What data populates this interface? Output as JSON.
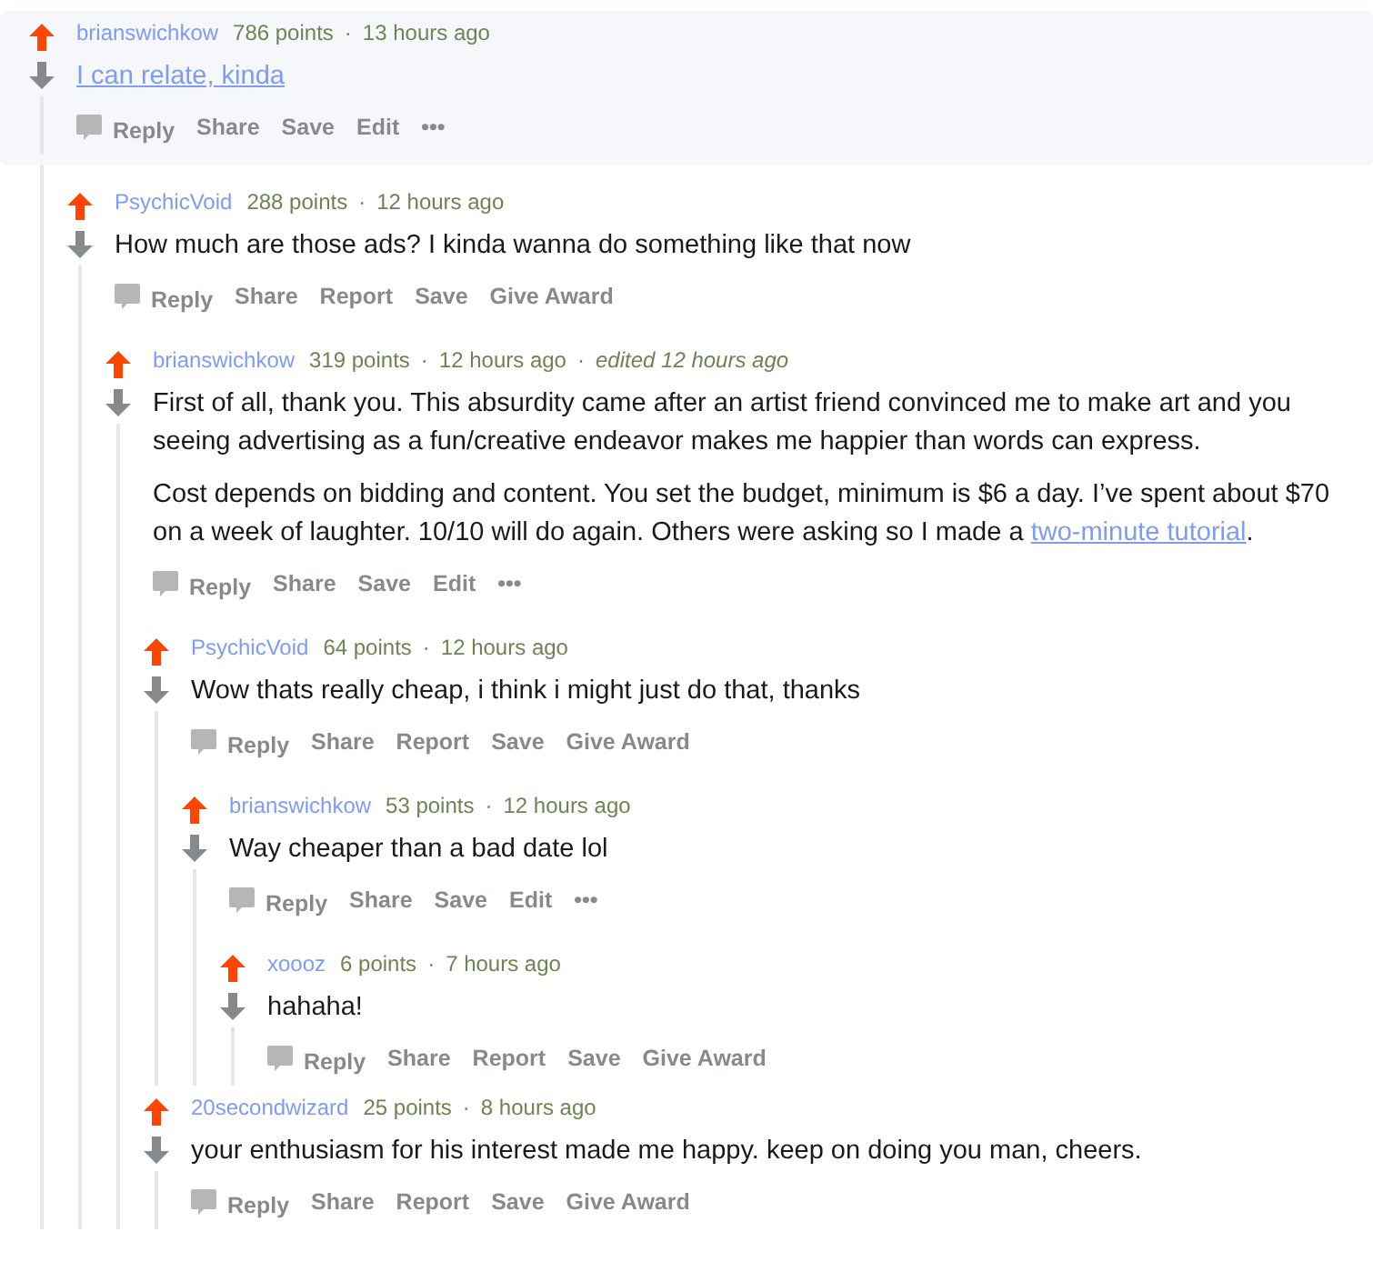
{
  "comments": [
    {
      "user": "brianswichkow",
      "upvoted": true,
      "highlighted": true,
      "meta": [
        {
          "text": "786 points"
        },
        {
          "text": "·"
        },
        {
          "text": "13 hours ago"
        }
      ],
      "body": [
        [
          {
            "kind": "link",
            "text": "I can relate, kinda"
          }
        ]
      ],
      "actions": [
        {
          "kind": "reply",
          "text": "Reply"
        },
        {
          "kind": "plain",
          "text": "Share"
        },
        {
          "kind": "plain",
          "text": "Save"
        },
        {
          "kind": "plain",
          "text": "Edit"
        },
        {
          "kind": "more",
          "text": "•••"
        }
      ],
      "children": [
        {
          "user": "PsychicVoid",
          "upvoted": true,
          "meta": [
            {
              "text": "288 points"
            },
            {
              "text": "·"
            },
            {
              "text": "12 hours ago"
            }
          ],
          "body": [
            [
              {
                "kind": "text",
                "text": "How much are those ads? I kinda wanna do something like that now"
              }
            ]
          ],
          "actions": [
            {
              "kind": "reply",
              "text": "Reply"
            },
            {
              "kind": "plain",
              "text": "Share"
            },
            {
              "kind": "plain",
              "text": "Report"
            },
            {
              "kind": "plain",
              "text": "Save"
            },
            {
              "kind": "plain",
              "text": "Give Award"
            }
          ],
          "children": [
            {
              "user": "brianswichkow",
              "upvoted": true,
              "meta": [
                {
                  "text": "319 points"
                },
                {
                  "text": "·"
                },
                {
                  "text": "12 hours ago"
                },
                {
                  "text": "·"
                },
                {
                  "text": "edited 12 hours ago",
                  "italic": true
                }
              ],
              "body": [
                [
                  {
                    "kind": "text",
                    "text": "First of all, thank you. This absurdity came after an artist friend convinced me to make art and you seeing advertising as a fun/creative endeavor makes me happier than words can express."
                  }
                ],
                [
                  {
                    "kind": "text",
                    "text": "Cost depends on bidding and content. You set the budget, minimum is $6 a day. I’ve spent about $70 on a week of laughter. 10/10 will do again. Others were asking so I made a "
                  },
                  {
                    "kind": "link",
                    "text": "two-minute tutorial"
                  },
                  {
                    "kind": "text",
                    "text": "."
                  }
                ]
              ],
              "actions": [
                {
                  "kind": "reply",
                  "text": "Reply"
                },
                {
                  "kind": "plain",
                  "text": "Share"
                },
                {
                  "kind": "plain",
                  "text": "Save"
                },
                {
                  "kind": "plain",
                  "text": "Edit"
                },
                {
                  "kind": "more",
                  "text": "•••"
                }
              ],
              "children": [
                {
                  "user": "PsychicVoid",
                  "upvoted": true,
                  "meta": [
                    {
                      "text": "64 points"
                    },
                    {
                      "text": "·"
                    },
                    {
                      "text": "12 hours ago"
                    }
                  ],
                  "body": [
                    [
                      {
                        "kind": "text",
                        "text": "Wow thats really cheap, i think i might just do that, thanks"
                      }
                    ]
                  ],
                  "actions": [
                    {
                      "kind": "reply",
                      "text": "Reply"
                    },
                    {
                      "kind": "plain",
                      "text": "Share"
                    },
                    {
                      "kind": "plain",
                      "text": "Report"
                    },
                    {
                      "kind": "plain",
                      "text": "Save"
                    },
                    {
                      "kind": "plain",
                      "text": "Give Award"
                    }
                  ],
                  "children": [
                    {
                      "user": "brianswichkow",
                      "upvoted": true,
                      "meta": [
                        {
                          "text": "53 points"
                        },
                        {
                          "text": "·"
                        },
                        {
                          "text": "12 hours ago"
                        }
                      ],
                      "body": [
                        [
                          {
                            "kind": "text",
                            "text": "Way cheaper than a bad date lol"
                          }
                        ]
                      ],
                      "actions": [
                        {
                          "kind": "reply",
                          "text": "Reply"
                        },
                        {
                          "kind": "plain",
                          "text": "Share"
                        },
                        {
                          "kind": "plain",
                          "text": "Save"
                        },
                        {
                          "kind": "plain",
                          "text": "Edit"
                        },
                        {
                          "kind": "more",
                          "text": "•••"
                        }
                      ],
                      "children": [
                        {
                          "user": "xoooz",
                          "upvoted": true,
                          "meta": [
                            {
                              "text": "6 points"
                            },
                            {
                              "text": "·"
                            },
                            {
                              "text": "7 hours ago"
                            }
                          ],
                          "body": [
                            [
                              {
                                "kind": "text",
                                "text": "hahaha!"
                              }
                            ]
                          ],
                          "actions": [
                            {
                              "kind": "reply",
                              "text": "Reply"
                            },
                            {
                              "kind": "plain",
                              "text": "Share"
                            },
                            {
                              "kind": "plain",
                              "text": "Report"
                            },
                            {
                              "kind": "plain",
                              "text": "Save"
                            },
                            {
                              "kind": "plain",
                              "text": "Give Award"
                            }
                          ]
                        }
                      ]
                    }
                  ]
                },
                {
                  "user": "20secondwizard",
                  "upvoted": true,
                  "meta": [
                    {
                      "text": "25 points"
                    },
                    {
                      "text": "·"
                    },
                    {
                      "text": "8 hours ago"
                    }
                  ],
                  "body": [
                    [
                      {
                        "kind": "text",
                        "text": "your enthusiasm for his interest made me happy. keep on doing you man, cheers."
                      }
                    ]
                  ],
                  "actions": [
                    {
                      "kind": "reply",
                      "text": "Reply"
                    },
                    {
                      "kind": "plain",
                      "text": "Share"
                    },
                    {
                      "kind": "plain",
                      "text": "Report"
                    },
                    {
                      "kind": "plain",
                      "text": "Save"
                    },
                    {
                      "kind": "plain",
                      "text": "Give Award"
                    }
                  ]
                }
              ]
            }
          ]
        }
      ]
    }
  ]
}
